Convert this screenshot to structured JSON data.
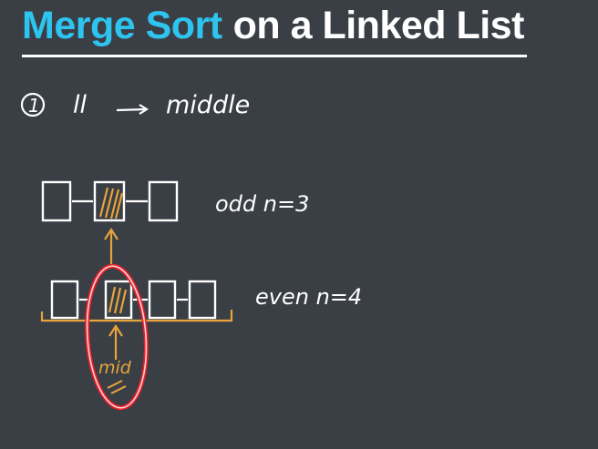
{
  "title": {
    "accent": "Merge Sort",
    "rest": "on a Linked List"
  },
  "notes": {
    "step_marker": "1",
    "step_text_left": "ll",
    "step_text_right": "middle",
    "odd_label": "odd n=3",
    "even_label": "even n=4",
    "mid_label": "mid"
  },
  "colors": {
    "background": "#3a3f45",
    "accent": "#2ec4f0",
    "ink": "#ffffff",
    "highlight": "#e8a33d",
    "circle": "#e8202a"
  }
}
